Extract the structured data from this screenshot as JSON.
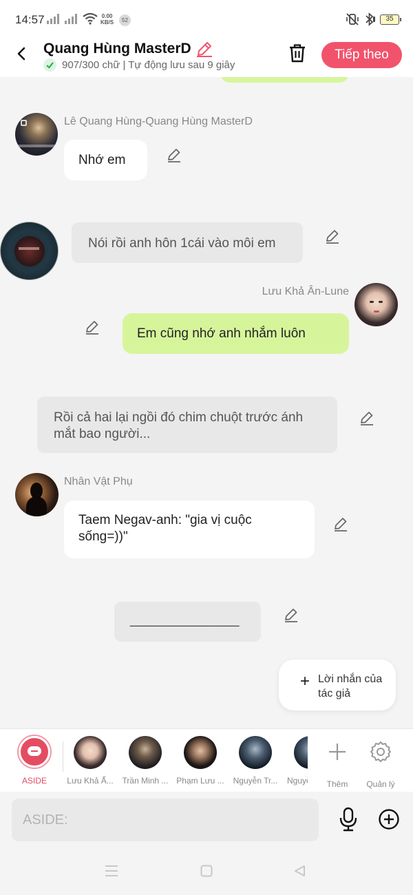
{
  "status_bar": {
    "time": "14:57",
    "net_speed_value": "0.00",
    "net_speed_unit": "KB/S",
    "notification_count": "52",
    "battery": "35"
  },
  "header": {
    "title": "Quang Hùng MasterD",
    "autosave_status": "907/300 chữ | Tự động lưu sau 9 giây",
    "next_label": "Tiếp theo"
  },
  "messages": [
    {
      "speaker": "Lê Quang Hùng-Quang Hùng MasterD",
      "text": "Nhớ em"
    },
    {
      "text": "Nói rồi anh hôn 1cái vào môi em"
    },
    {
      "speaker": "Lưu Khả Ân-Lune",
      "text": "Em cũng nhớ anh nhắm luôn"
    },
    {
      "text": "Rồi cả hai lại ngồi đó chim chuột trước ánh mắt bao người..."
    },
    {
      "speaker": "Nhân Vật Phụ",
      "text": "Taem Negav-anh: \"gia vị cuộc sống=))\""
    },
    {
      "text": "_______________"
    }
  ],
  "author_note_button": "Lời nhắn của tác giả",
  "characters": [
    {
      "label": "ASIDE"
    },
    {
      "label": "Lưu Khả Ấ..."
    },
    {
      "label": "Trần Minh ..."
    },
    {
      "label": "Phạm Lưu ..."
    },
    {
      "label": "Nguyễn Tr..."
    },
    {
      "label": "Nguyễ"
    }
  ],
  "add_label": "Thêm",
  "manage_label": "Quản lý",
  "input": {
    "placeholder": "ASIDE:"
  },
  "colors": {
    "accent": "#f2536c",
    "user_bubble": "#d6f59b",
    "narration_bubble": "#e8e8e8"
  }
}
